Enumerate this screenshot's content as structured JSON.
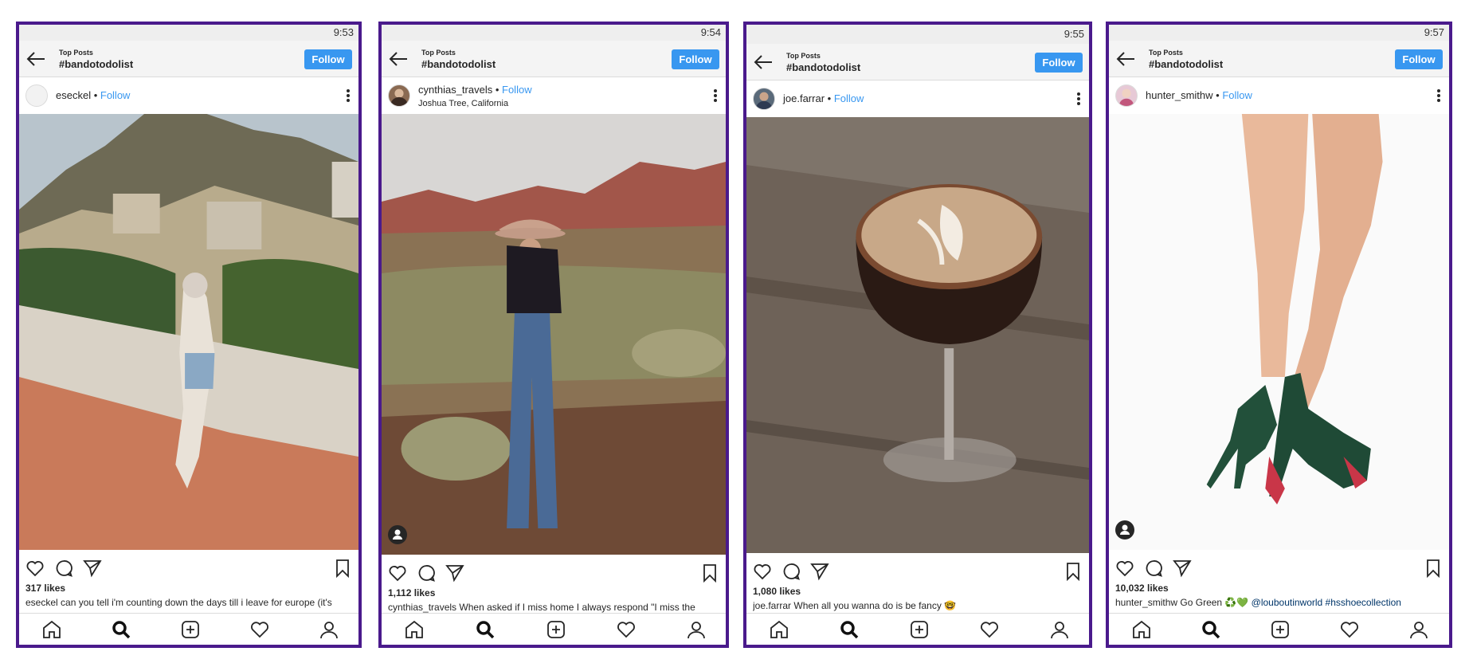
{
  "header": {
    "small_label": "Top Posts",
    "hashtag": "#bandotodolist",
    "follow_label": "Follow"
  },
  "posts": [
    {
      "time": "9:53",
      "username": "eseckel",
      "follow_link": "Follow",
      "location": "",
      "likes": "317 likes",
      "caption_user": "eseckel",
      "caption_text": "can you tell i'm counting down the days till i leave for europe (it's",
      "caption_links": ""
    },
    {
      "time": "9:54",
      "username": "cynthias_travels",
      "follow_link": "Follow",
      "location": "Joshua Tree, California",
      "likes": "1,112 likes",
      "caption_user": "cynthias_travels",
      "caption_text": "When asked if I miss home I always respond \"I miss the",
      "caption_links": ""
    },
    {
      "time": "9:55",
      "username": "joe.farrar",
      "follow_link": "Follow",
      "location": "",
      "likes": "1,080 likes",
      "caption_user": "joe.farrar",
      "caption_text": "When all you wanna do is be fancy 🤓",
      "caption_links": ""
    },
    {
      "time": "9:57",
      "username": "hunter_smithw",
      "follow_link": "Follow",
      "location": "",
      "likes": "10,032 likes",
      "caption_user": "hunter_smithw",
      "caption_text": "Go Green ♻️💚",
      "caption_links": "@louboutinworld #hsshoecollection"
    }
  ],
  "colors": {
    "frame": "#4a1a8c",
    "follow_blue": "#3897f0",
    "link_navy": "#003569"
  },
  "icons": [
    "back-arrow-icon",
    "more-icon",
    "heart-icon",
    "comment-icon",
    "share-icon",
    "bookmark-icon",
    "home-icon",
    "search-icon",
    "add-icon",
    "activity-heart-icon",
    "profile-icon",
    "tag-people-icon"
  ]
}
